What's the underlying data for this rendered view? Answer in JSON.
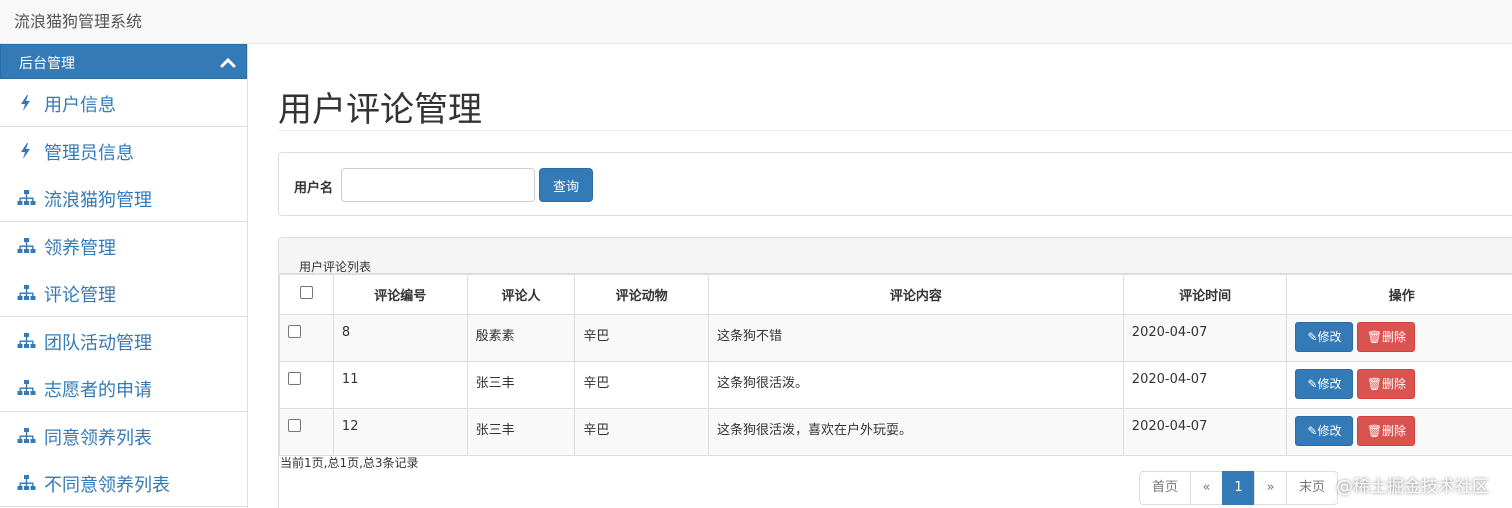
{
  "app": {
    "title": "流浪猫狗管理系统"
  },
  "sidebar": {
    "header": "后台管理",
    "items": [
      {
        "label": "用户信息",
        "icon": "bolt-icon"
      },
      {
        "label": "管理员信息",
        "icon": "bolt-icon"
      },
      {
        "label": "流浪猫狗管理",
        "icon": "sitemap-icon"
      },
      {
        "label": "领养管理",
        "icon": "sitemap-icon"
      },
      {
        "label": "评论管理",
        "icon": "sitemap-icon"
      },
      {
        "label": "团队活动管理",
        "icon": "sitemap-icon"
      },
      {
        "label": "志愿者的申请",
        "icon": "sitemap-icon"
      },
      {
        "label": "同意领养列表",
        "icon": "sitemap-icon"
      },
      {
        "label": "不同意领养列表",
        "icon": "sitemap-icon"
      }
    ]
  },
  "main": {
    "title": "用户评论管理",
    "search": {
      "label": "用户名",
      "value": "",
      "button": "查询"
    },
    "list": {
      "title": "用户评论列表",
      "columns": [
        "评论编号",
        "评论人",
        "评论动物",
        "评论内容",
        "评论时间",
        "操作"
      ],
      "rows": [
        {
          "id": "8",
          "user": "殷素素",
          "animal": "辛巴",
          "content": "这条狗不错",
          "time": "2020-04-07"
        },
        {
          "id": "11",
          "user": "张三丰",
          "animal": "辛巴",
          "content": "这条狗很活泼。",
          "time": "2020-04-07"
        },
        {
          "id": "12",
          "user": "张三丰",
          "animal": "辛巴",
          "content": "这条狗很活泼，喜欢在户外玩耍。",
          "time": "2020-04-07"
        }
      ],
      "edit_label": "修改",
      "delete_label": "删除"
    },
    "pagination": {
      "info": "当前1页,总1页,总3条记录",
      "first": "首页",
      "prev": "«",
      "current": "1",
      "next": "»",
      "last": "末页"
    }
  },
  "watermark": "@稀土掘金技术社区",
  "colors": {
    "primary": "#337ab7",
    "danger": "#d9534f",
    "navbar": "#f8f8f8"
  }
}
